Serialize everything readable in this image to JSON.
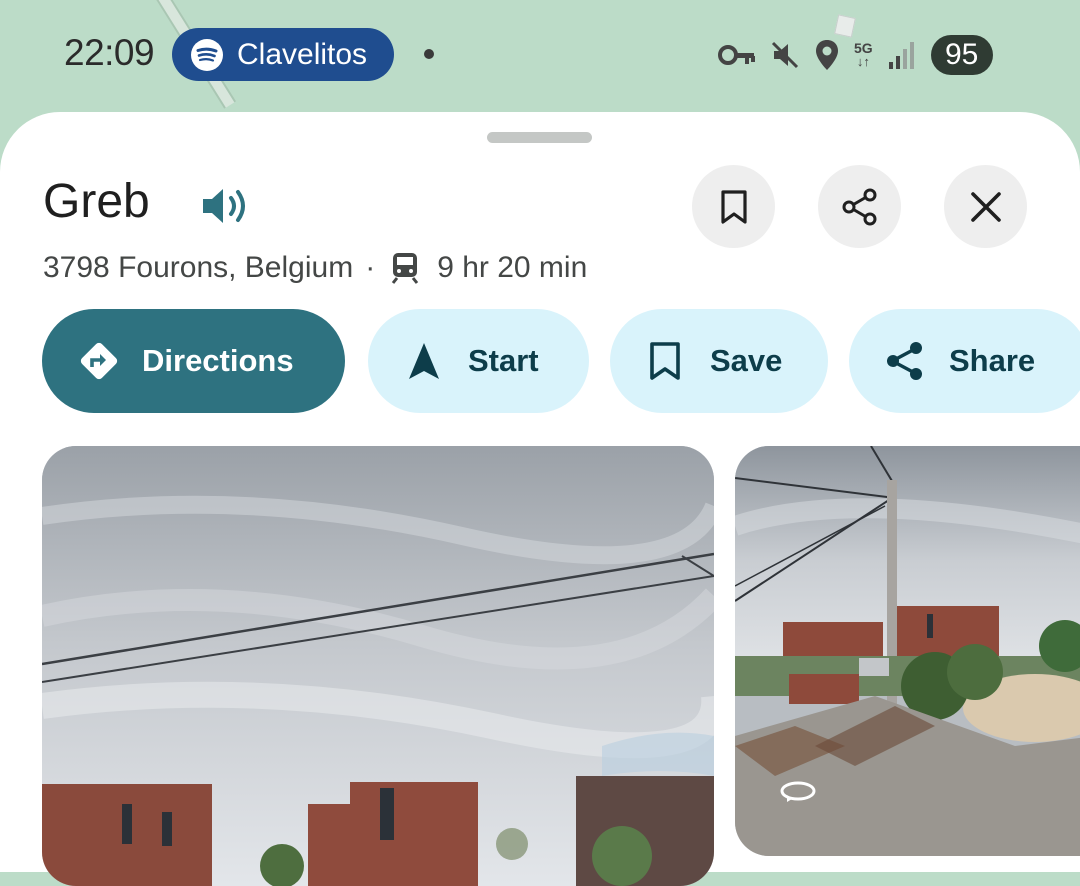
{
  "status_bar": {
    "time": "22:09",
    "media_chip": {
      "app_icon": "spotify-icon",
      "label": "Clavelitos"
    },
    "icons": [
      "vpn-key-icon",
      "mute-icon",
      "location-icon",
      "5g-network-icon",
      "signal-icon"
    ],
    "network_label": "5G",
    "battery": "95"
  },
  "place": {
    "name": "Greb",
    "address": "3798 Fourons, Belgium",
    "separator": "·",
    "transit_time": "9 hr 20 min"
  },
  "header_actions": [
    "bookmark-icon",
    "share-icon",
    "close-icon"
  ],
  "actions": [
    {
      "label": "Directions",
      "icon": "directions-icon"
    },
    {
      "label": "Start",
      "icon": "navigation-arrow-icon"
    },
    {
      "label": "Save",
      "icon": "bookmark-icon"
    },
    {
      "label": "Share",
      "icon": "share-icon"
    }
  ],
  "photos": [
    {
      "kind": "street-view",
      "icon": ""
    },
    {
      "kind": "street-view",
      "icon": "360-rotate-icon"
    }
  ],
  "colors": {
    "primary": "#2e7280",
    "chip_bg": "#d9f3fb",
    "map_bg": "#bcdcc8",
    "spotify_chip": "#1f4d8f"
  }
}
